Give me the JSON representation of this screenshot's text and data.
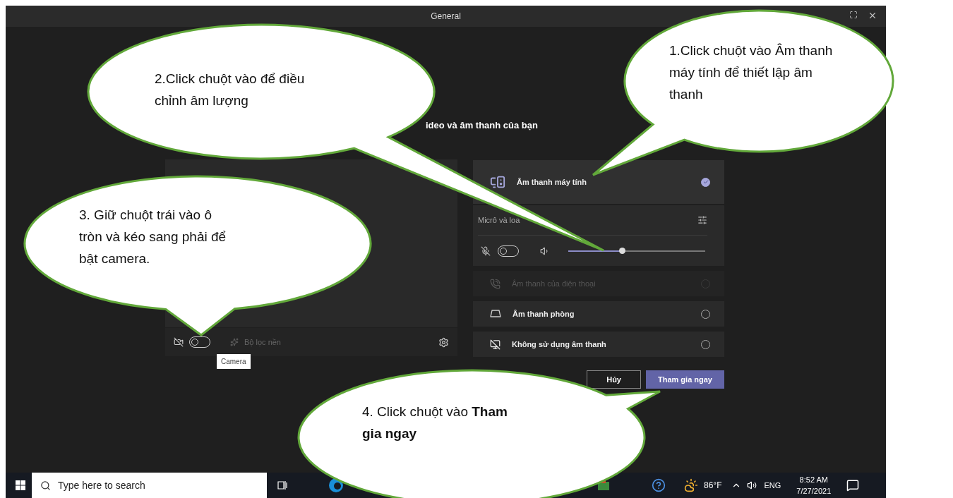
{
  "window": {
    "title": "General"
  },
  "heading": "ideo và âm thanh của bạn",
  "video_panel": {
    "camera_on": false,
    "background_filter": "Bộ lọc nền",
    "tooltip": "Camera"
  },
  "device_settings": {
    "label": "Micrô và loa",
    "mic_on": false,
    "level": 0.39
  },
  "audio_options": [
    {
      "kind": "computer",
      "label": "Âm thanh máy tính",
      "selected": true,
      "disabled": false
    },
    {
      "kind": "phone",
      "label": "Âm thanh của điện thoại",
      "selected": false,
      "disabled": true
    },
    {
      "kind": "room",
      "label": "Âm thanh phòng",
      "selected": false,
      "disabled": false
    },
    {
      "kind": "none",
      "label": "Không sử dụng âm thanh",
      "selected": false,
      "disabled": false
    }
  ],
  "buttons": [
    {
      "kind": "secondary",
      "label": "Hủy"
    },
    {
      "kind": "primary",
      "label": "Tham gia ngay"
    }
  ],
  "taskbar": {
    "search_placeholder": "Type here to search",
    "temperature": "86°F",
    "language": "ENG",
    "time": "8:52 AM",
    "date": "7/27/2021"
  },
  "callouts": [
    {
      "text": "1.Click chuột vào Âm thanh máy tính để thiết lập âm thanh"
    },
    {
      "text": "2.Click chuột vào để điều chỉnh âm lượng"
    },
    {
      "text": "3. Giữ chuột trái vào ô tròn và kéo sang phải để bật camera."
    },
    {
      "text": "4. Click chuột vào **Tham gia ngay**"
    }
  ]
}
